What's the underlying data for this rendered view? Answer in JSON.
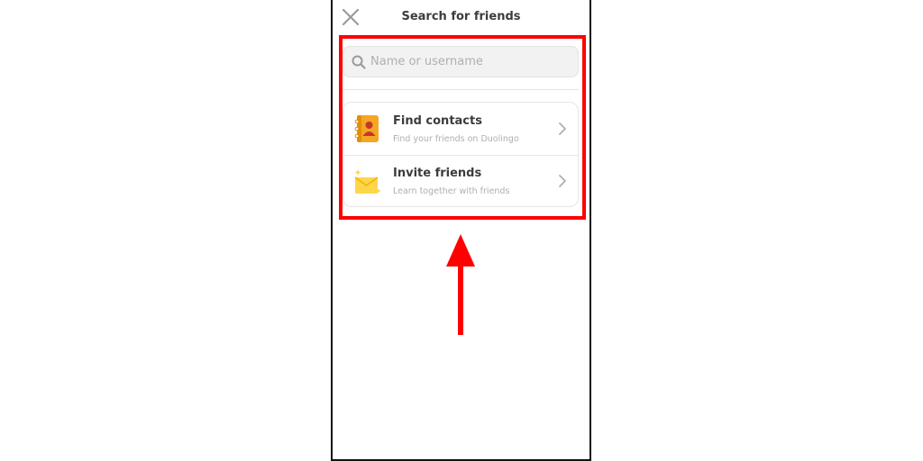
{
  "header": {
    "title": "Search for friends"
  },
  "search": {
    "placeholder": "Name or username",
    "value": ""
  },
  "options": [
    {
      "title": "Find contacts",
      "subtitle": "Find your friends on Duolingo",
      "icon": "contacts-book-icon"
    },
    {
      "title": "Invite friends",
      "subtitle": "Learn together with friends",
      "icon": "envelope-icon"
    }
  ],
  "colors": {
    "highlight": "#ff0000",
    "book": "#f5a623",
    "envelope": "#ffd54a",
    "text": "#3c3c3c",
    "muted": "#afafaf"
  }
}
